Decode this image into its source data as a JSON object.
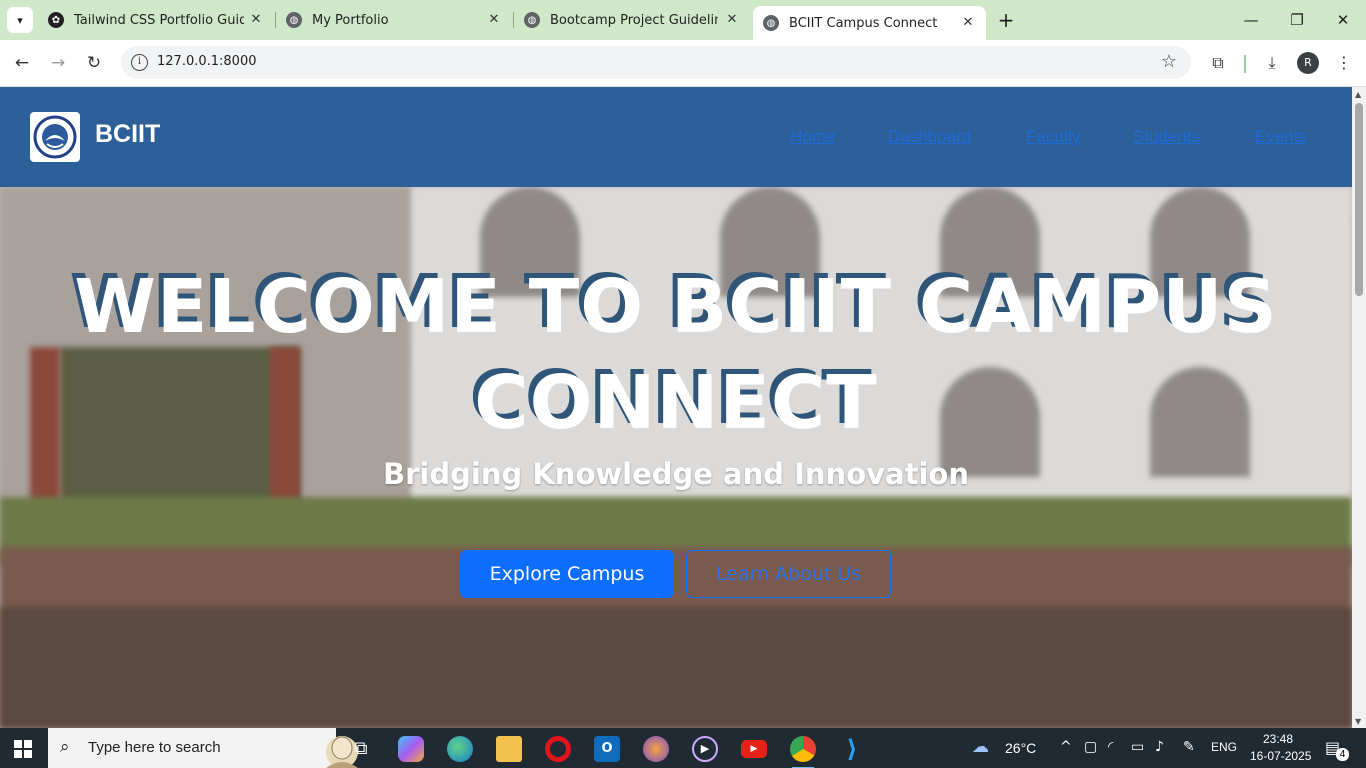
{
  "browser": {
    "tabs": [
      {
        "title": "Tailwind CSS Portfolio Guide",
        "active": false
      },
      {
        "title": "My Portfolio",
        "active": false
      },
      {
        "title": "Bootcamp Project Guidelines: To",
        "active": false
      },
      {
        "title": "BCIIT Campus Connect",
        "active": true
      }
    ],
    "url": "127.0.0.1:8000",
    "profile_initial": "R"
  },
  "site": {
    "brand": "BCIIT",
    "nav": [
      "Home",
      "Dashboard",
      "Faculty",
      "Students",
      "Events"
    ],
    "hero_title_line1": "WELCOME TO BCIIT CAMPUS",
    "hero_title_line2": "CONNECT",
    "hero_subtitle": "Bridging Knowledge and Innovation",
    "primary_button": "Explore Campus",
    "secondary_button": "Learn About Us",
    "colors": {
      "nav_bg": "#2d5f99",
      "primary": "#0d6efd"
    }
  },
  "taskbar": {
    "search_placeholder": "Type here to search",
    "weather": "26°C",
    "language": "ENG",
    "time": "23:48",
    "date": "16-07-2025",
    "notification_count": "4"
  }
}
